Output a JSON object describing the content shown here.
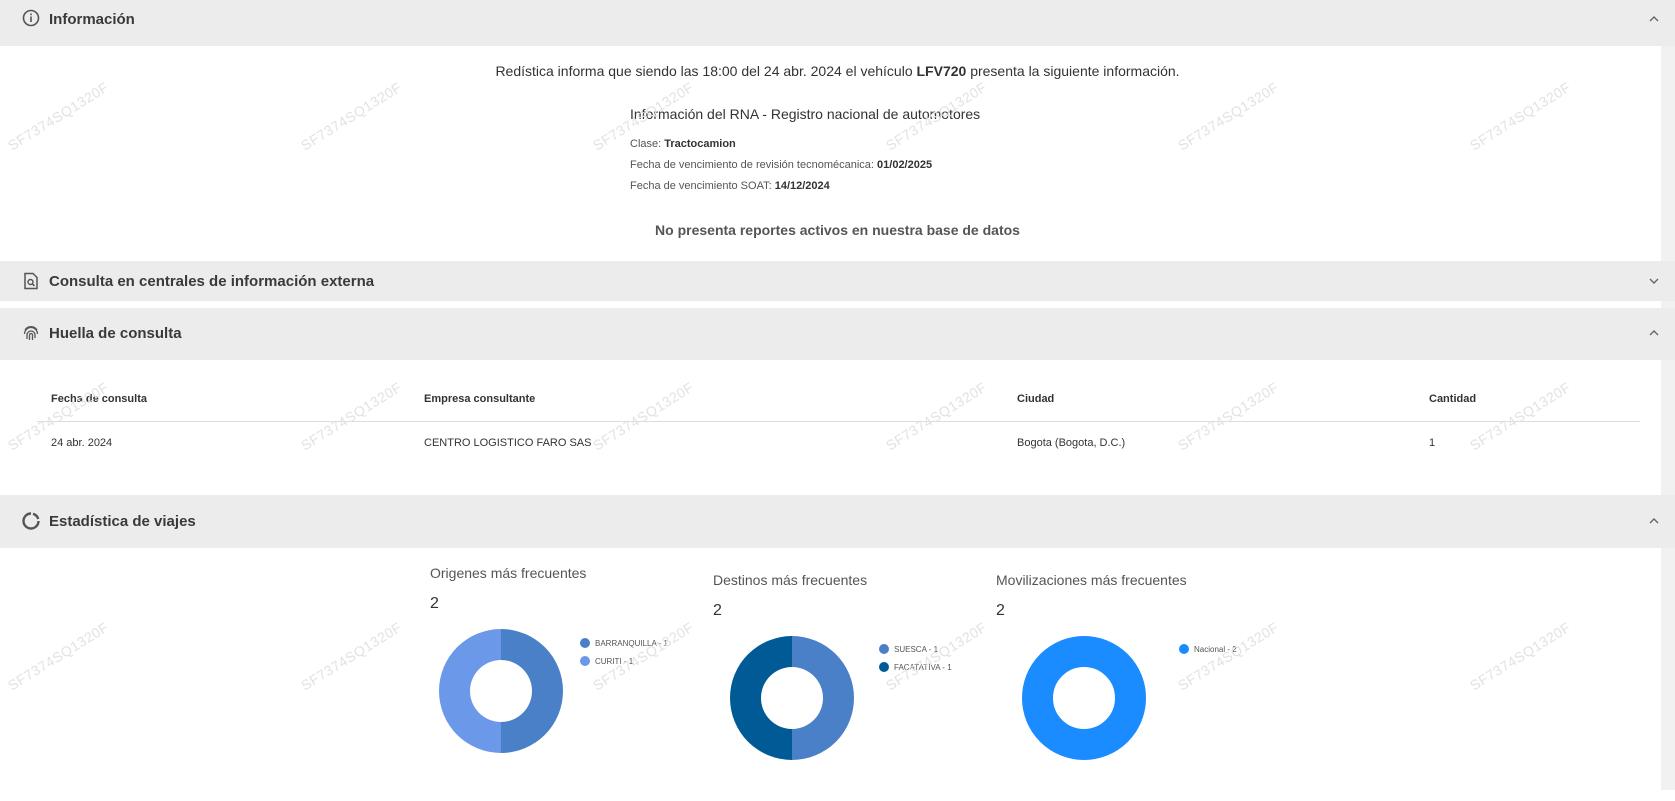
{
  "watermark": "SF7374SQ1320F",
  "informacion": {
    "title": "Información",
    "line_prefix": "Redística informa que siendo las 18:00 del 24 abr. 2024 el vehículo ",
    "plate": "LFV720",
    "line_suffix": " presenta la siguiente información.",
    "rna_title": "Información del RNA - Registro nacional de automotores",
    "clase_label": "Clase: ",
    "clase_value": "Tractocamion",
    "tecno_label": "Fecha de vencimiento de revisión tecnomécanica: ",
    "tecno_value": "01/02/2025",
    "soat_label": "Fecha de vencimiento SOAT: ",
    "soat_value": "14/12/2024",
    "no_reports": "No presenta reportes activos en nuestra base de datos"
  },
  "consulta": {
    "title": "Consulta en centrales de información externa"
  },
  "huella": {
    "title": "Huella de consulta",
    "columns": [
      "Fecha de consulta",
      "Empresa consultante",
      "Ciudad",
      "Cantidad"
    ],
    "rows": [
      [
        "24 abr. 2024",
        "CENTRO LOGISTICO FARO SAS",
        "Bogota (Bogota, D.C.)",
        "1"
      ]
    ]
  },
  "estadistica": {
    "title": "Estadística de viajes"
  },
  "chart_data": [
    {
      "type": "pie",
      "title": "Origenes más frecuentes",
      "total": "2",
      "categories": [
        "BARRANQUILLA - 1",
        "CURITI - 1"
      ],
      "values": [
        1,
        1
      ],
      "colors": [
        "#4a80c8",
        "#6b98e8"
      ]
    },
    {
      "type": "pie",
      "title": "Destinos más frecuentes",
      "total": "2",
      "categories": [
        "SUESCA - 1",
        "FACATATIVA - 1"
      ],
      "values": [
        1,
        1
      ],
      "colors": [
        "#4a80c8",
        "#005a96"
      ]
    },
    {
      "type": "pie",
      "title": "Movilizaciones más frecuentes",
      "total": "2",
      "categories": [
        "Nacional - 2"
      ],
      "values": [
        2
      ],
      "colors": [
        "#1a8cff"
      ]
    }
  ]
}
